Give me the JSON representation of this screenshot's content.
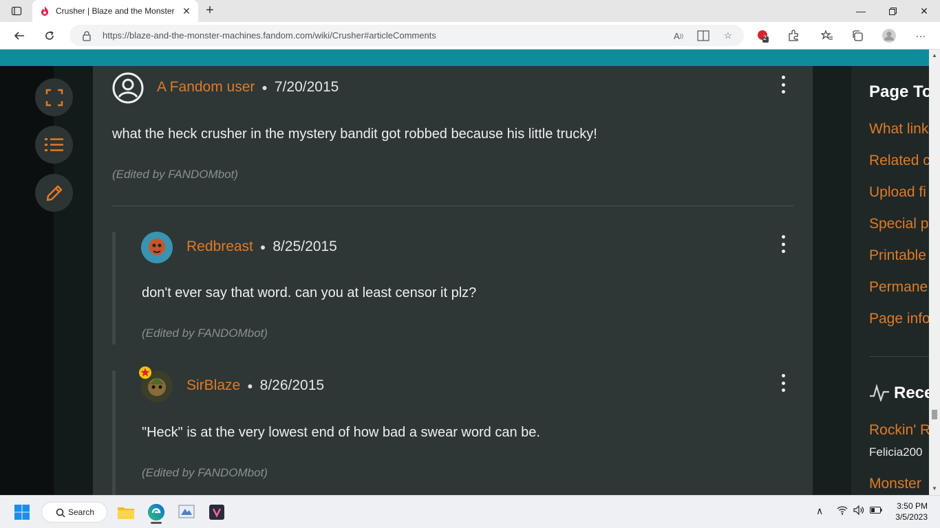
{
  "browser": {
    "tab_title": "Crusher | Blaze and the Monster",
    "url": "https://blaze-and-the-monster-machines.fandom.com/wiki/Crusher#articleComments",
    "extension_badge": "2"
  },
  "comments": [
    {
      "username": "A Fandom user",
      "date": "7/20/2015",
      "body": "what the heck crusher in the mystery bandit got robbed because his little trucky!",
      "edited": "(Edited by FANDOMbot)"
    },
    {
      "username": "Redbreast",
      "date": "8/25/2015",
      "body": "don't  ever say that word. can you at least censor it plz?",
      "edited": "(Edited by FANDOMbot)"
    },
    {
      "username": "SirBlaze",
      "date": "8/26/2015",
      "body": "\"Heck\" is at the very lowest end of how bad a swear word can be.",
      "edited": "(Edited by FANDOMbot)"
    }
  ],
  "sidebar": {
    "title": "Page To",
    "links": [
      "What link",
      "Related c",
      "Upload fi",
      "Special p",
      "Printable",
      "Permane",
      "Page info"
    ],
    "recent_title": "Rece",
    "recent_item": "Rockin' R",
    "recent_user": "Felicia200",
    "recent_item_2": "Monster"
  },
  "taskbar": {
    "search_label": "Search",
    "time": "3:50 PM",
    "date": "3/5/2023"
  },
  "colors": {
    "accent": "#e07b25",
    "teal": "#0f8c9b",
    "panel": "#2e3636"
  }
}
